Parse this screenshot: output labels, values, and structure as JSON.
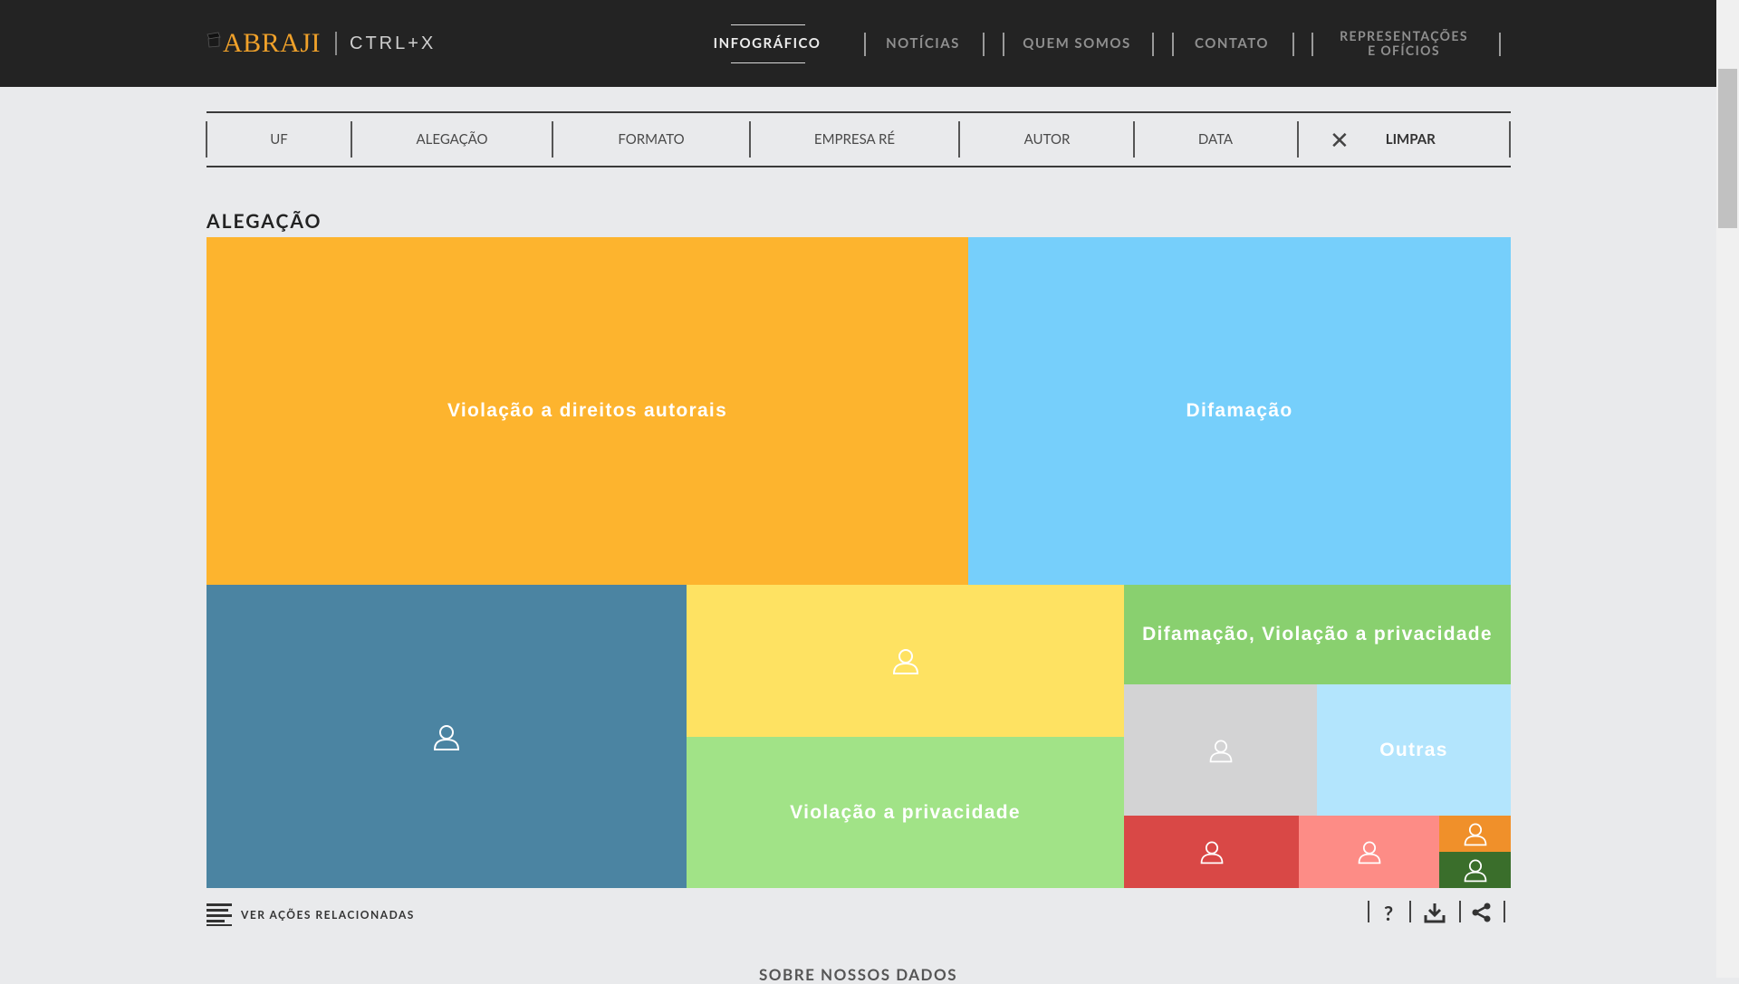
{
  "header": {
    "logo_text": "ABRAJI",
    "logo_sub": "CTRL+X",
    "nav": [
      {
        "label": "INFOGRÁFICO",
        "active": true
      },
      {
        "label": "NOTÍCIAS"
      },
      {
        "label": "QUEM SOMOS"
      },
      {
        "label": "CONTATO"
      },
      {
        "label_line1": "REPRESENTAÇÕES",
        "label_line2": "E OFÍCIOS"
      }
    ]
  },
  "filters": {
    "items": [
      "UF",
      "ALEGAÇÃO",
      "FORMATO",
      "EMPRESA RÉ",
      "AUTOR",
      "DATA"
    ],
    "clear_icon": "close-icon",
    "clear_label": "LIMPAR"
  },
  "section": {
    "title": "ALEGAÇÃO"
  },
  "treemap": {
    "cells": [
      {
        "label": "Violação a direitos autorais",
        "color": "#fdb42e"
      },
      {
        "label": "Difamação",
        "color": "#76cffb"
      },
      {
        "label": "",
        "color": "#4b84a2",
        "icon": "person-icon"
      },
      {
        "label": "",
        "color": "#fee262",
        "icon": "person-icon"
      },
      {
        "label": "Violação a privacidade",
        "color": "#a1e387"
      },
      {
        "label": "Difamação, Violação a privacidade",
        "color": "#89d06f"
      },
      {
        "label": "",
        "color": "#d3d3d4",
        "icon": "person-icon"
      },
      {
        "label": "Outras",
        "color": "#b3e5fd"
      },
      {
        "label": "",
        "color": "#d94846",
        "icon": "person-icon"
      },
      {
        "label": "",
        "color": "#fd8c86",
        "icon": "person-icon"
      },
      {
        "label": "",
        "color": "#f0902a",
        "icon": "person-icon"
      },
      {
        "label": "",
        "color": "#3a6e2b",
        "icon": "person-icon"
      }
    ]
  },
  "footer": {
    "related_label": "VER AÇÕES RELACIONADAS",
    "tools": [
      "help-icon",
      "download-icon",
      "share-icon"
    ],
    "help_glyph": "?",
    "about_label": "SOBRE NOSSOS DADOS"
  }
}
